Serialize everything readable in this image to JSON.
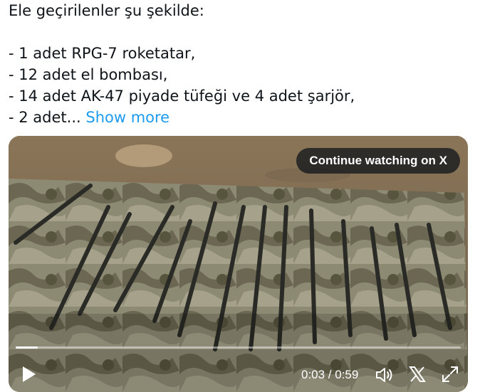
{
  "tweet": {
    "lines": [
      "Ele geçirilenler şu şekilde:",
      "- 1 adet RPG-7 roketatar,",
      "- 12 adet el bombası,",
      "- 14 adet AK-47 piyade tüfeği ve 4 adet şarjör,"
    ],
    "last_line_prefix": "- 2 adet...",
    "show_more_label": "Show more"
  },
  "video": {
    "continue_label": "Continue watching on X",
    "time_display": "0:03 / 0:59",
    "progress_fraction": 0.05,
    "colors": {
      "link": "#1d9bf0",
      "overlay": "#0f1419"
    }
  }
}
